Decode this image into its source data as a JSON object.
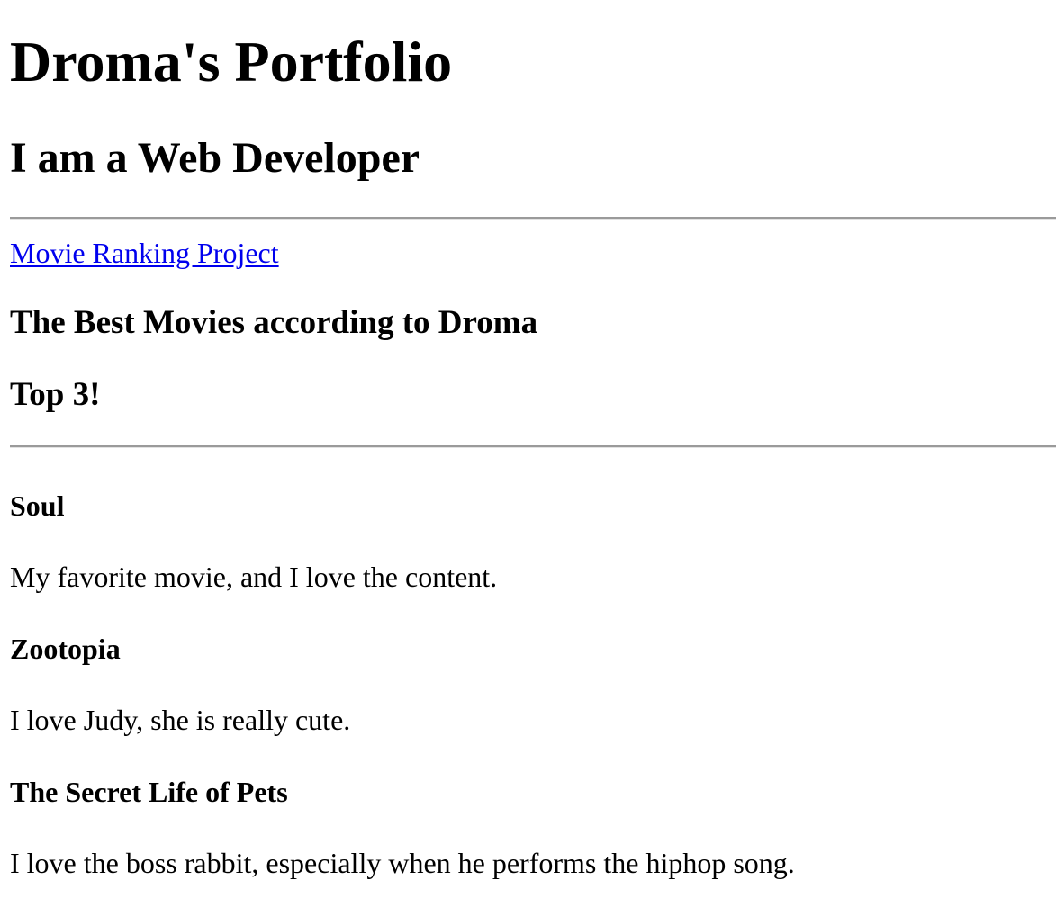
{
  "header": {
    "title": "Droma's Portfolio",
    "subtitle": "I am a Web Developer"
  },
  "project": {
    "link_label": "Movie Ranking Project",
    "link_color": "#0000ee"
  },
  "ranking": {
    "heading": "The Best Movies according to Droma",
    "subheading": "Top 3!",
    "movies": [
      {
        "title": "Soul",
        "description": "My favorite movie, and I love the content."
      },
      {
        "title": "Zootopia",
        "description": "I love Judy, she is really cute."
      },
      {
        "title": "The Secret Life of Pets",
        "description": "I love the boss rabbit, especially when he performs the hiphop song."
      }
    ]
  }
}
